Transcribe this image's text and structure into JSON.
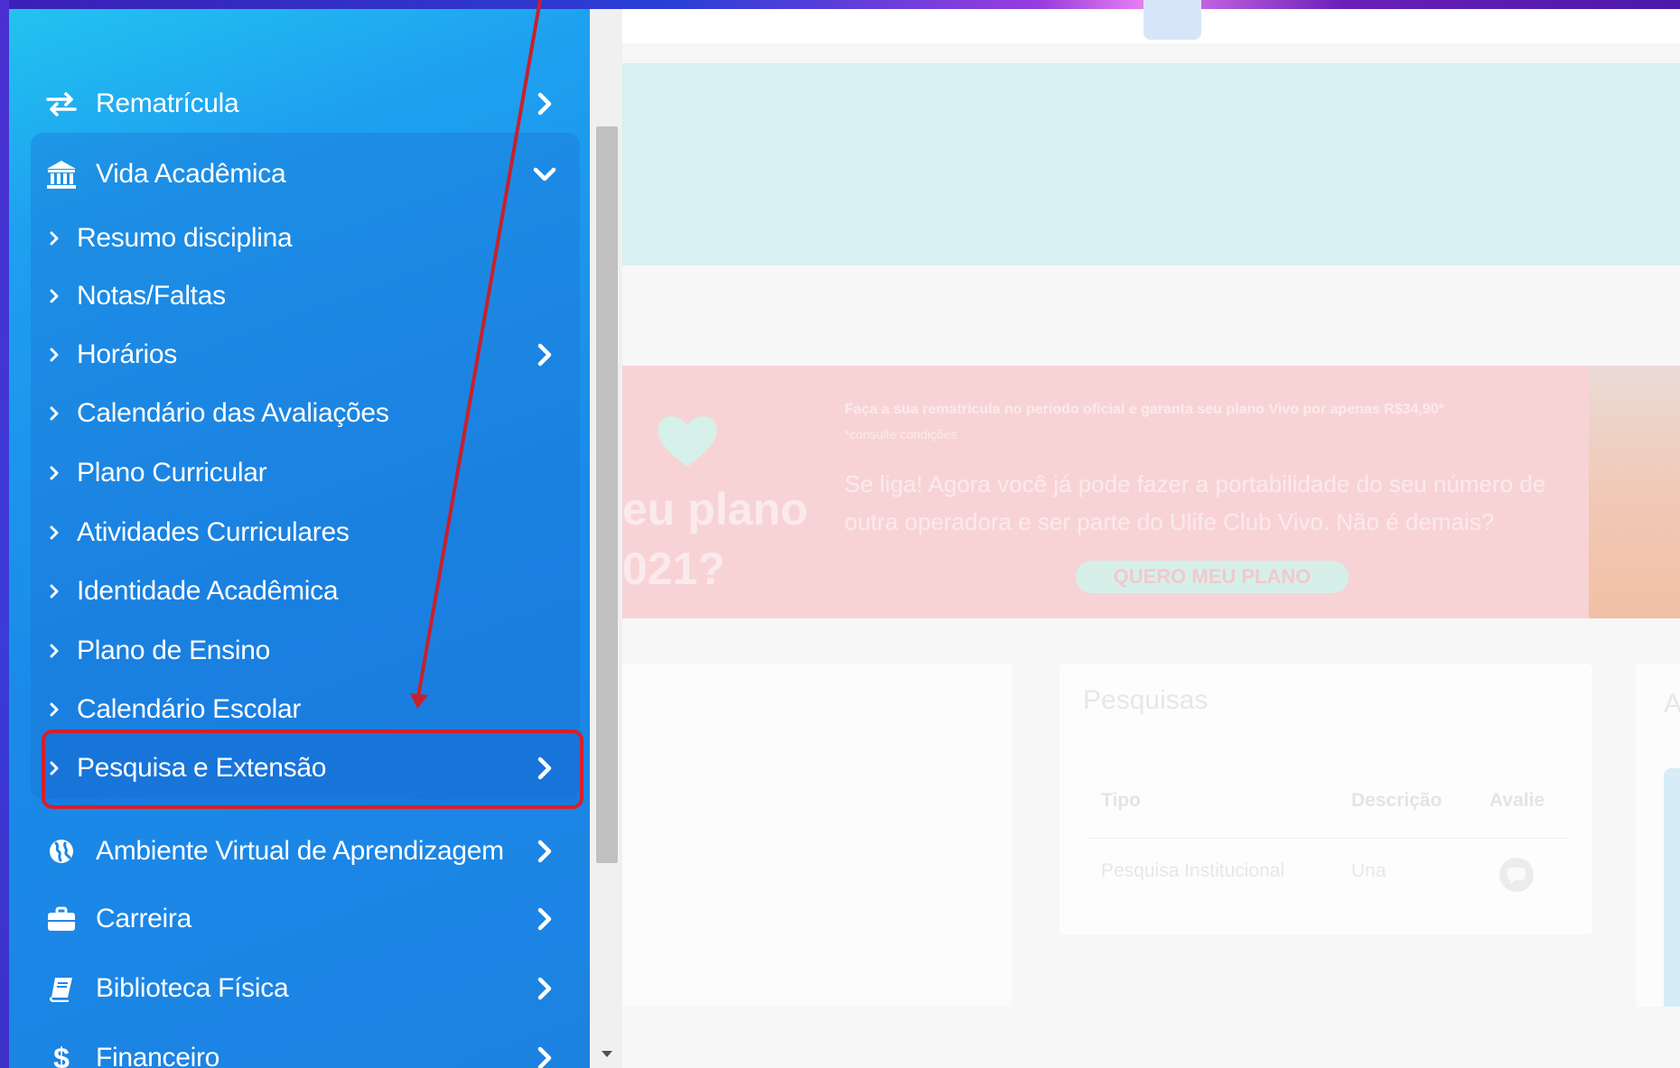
{
  "sidebar": {
    "top_items": [
      {
        "label": "Rematrícula",
        "icon": "swap-arrows-icon"
      },
      {
        "label": "Vida Acadêmica",
        "icon": "institution-icon"
      }
    ],
    "sub_items": [
      {
        "label": "Resumo disciplina"
      },
      {
        "label": "Notas/Faltas"
      },
      {
        "label": "Horários"
      },
      {
        "label": "Calendário das Avaliações"
      },
      {
        "label": "Plano Curricular"
      },
      {
        "label": "Atividades Curriculares"
      },
      {
        "label": "Identidade Acadêmica"
      },
      {
        "label": "Plano de Ensino"
      },
      {
        "label": "Calendário Escolar"
      },
      {
        "label": "Pesquisa e Extensão"
      }
    ],
    "bottom_items": [
      {
        "label": "Ambiente Virtual de Aprendizagem",
        "icon": "globe-icon"
      },
      {
        "label": "Carreira",
        "icon": "briefcase-icon"
      },
      {
        "label": "Biblioteca Física",
        "icon": "book-icon"
      },
      {
        "label": "Financeiro",
        "icon": "dollar-icon"
      }
    ]
  },
  "promo": {
    "headline_1": "eu plano",
    "headline_2": "021?",
    "small_1": "Faça a sua rematrícula no período oficial e garanta seu plano Vivo por apenas R$34,90*",
    "small_2": "*consulte condições",
    "para_1": "Se liga! Agora você já pode fazer a portabilidade do seu número de",
    "para_2": "outra operadora e ser parte do Ulife Club Vivo. Não é demais?",
    "cta": "QUERO MEU PLANO"
  },
  "pesquisas": {
    "title": "Pesquisas",
    "headers": [
      "Tipo",
      "Descrição",
      "Avalie"
    ],
    "row": [
      "Pesquisa Institucional",
      "Una"
    ]
  },
  "right_card": {
    "initial": "A"
  },
  "colors": {
    "sidebar_start": "#22c3f0",
    "sidebar_end": "#1c82e2",
    "highlight_border": "#d81f2a",
    "arrow": "#c8202c"
  }
}
